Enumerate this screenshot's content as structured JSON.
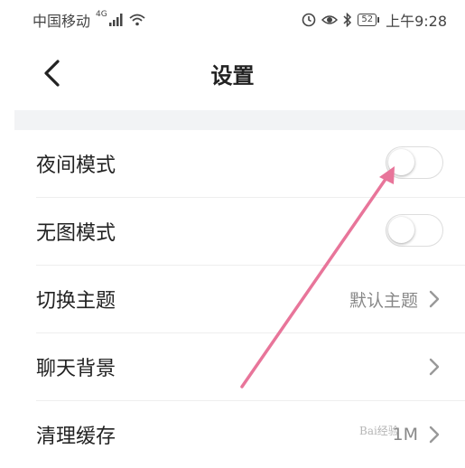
{
  "status_bar": {
    "carrier": "中国移动",
    "network": "4G",
    "battery": "52",
    "time": "上午9:28"
  },
  "nav": {
    "title": "设置"
  },
  "rows": [
    {
      "label": "夜间模式",
      "control": "toggle",
      "on": false
    },
    {
      "label": "无图模式",
      "control": "toggle",
      "on": false
    },
    {
      "label": "切换主题",
      "control": "chevron",
      "value": "默认主题"
    },
    {
      "label": "聊天背景",
      "control": "chevron",
      "value": ""
    },
    {
      "label": "清理缓存",
      "control": "chevron",
      "value": "1M"
    }
  ],
  "icons": {
    "back": "chevron-left-icon",
    "row_arrow": "chevron-right-icon"
  },
  "colors": {
    "annotation_arrow": "#e8759a",
    "separator_band": "#f2f3f5"
  },
  "watermark": {
    "text": "Bai经验"
  }
}
